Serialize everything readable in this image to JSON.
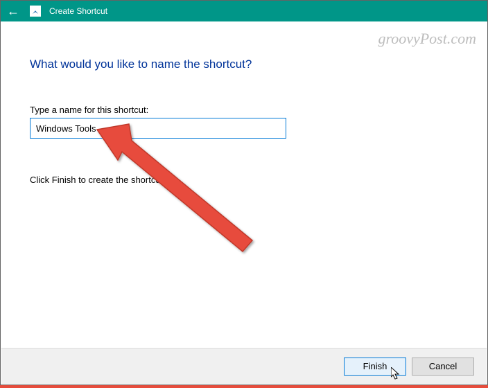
{
  "titlebar": {
    "back": "←",
    "title": "Create Shortcut"
  },
  "content": {
    "heading": "What would you like to name the shortcut?",
    "label": "Type a name for this shortcut:",
    "input_value": "Windows Tools",
    "hint": "Click Finish to create the shortcut."
  },
  "buttons": {
    "finish": "Finish",
    "cancel": "Cancel"
  },
  "watermark": "groovyPost.com"
}
